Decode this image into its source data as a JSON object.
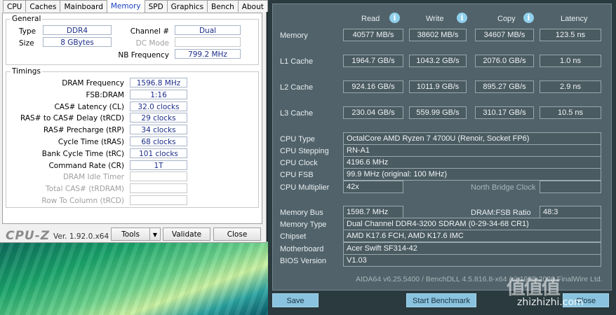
{
  "cpuz": {
    "tabs": [
      "CPU",
      "Caches",
      "Mainboard",
      "Memory",
      "SPD",
      "Graphics",
      "Bench",
      "About"
    ],
    "active_tab": "Memory",
    "general": {
      "title": "General",
      "type_label": "Type",
      "type_value": "DDR4",
      "size_label": "Size",
      "size_value": "8 GBytes",
      "channel_label": "Channel #",
      "channel_value": "Dual",
      "dcmode_label": "DC Mode",
      "dcmode_value": "",
      "nbfreq_label": "NB Frequency",
      "nbfreq_value": "799.2 MHz"
    },
    "timings": {
      "title": "Timings",
      "rows": [
        {
          "label": "DRAM Frequency",
          "value": "1596.8 MHz",
          "enabled": true
        },
        {
          "label": "FSB:DRAM",
          "value": "1:16",
          "enabled": true
        },
        {
          "label": "CAS# Latency (CL)",
          "value": "32.0 clocks",
          "enabled": true
        },
        {
          "label": "RAS# to CAS# Delay (tRCD)",
          "value": "29 clocks",
          "enabled": true
        },
        {
          "label": "RAS# Precharge (tRP)",
          "value": "34 clocks",
          "enabled": true
        },
        {
          "label": "Cycle Time (tRAS)",
          "value": "68 clocks",
          "enabled": true
        },
        {
          "label": "Bank Cycle Time (tRC)",
          "value": "101 clocks",
          "enabled": true
        },
        {
          "label": "Command Rate (CR)",
          "value": "1T",
          "enabled": true
        },
        {
          "label": "DRAM Idle Timer",
          "value": "",
          "enabled": false
        },
        {
          "label": "Total CAS# (tRDRAM)",
          "value": "",
          "enabled": false
        },
        {
          "label": "Row To Column (tRCD)",
          "value": "",
          "enabled": false
        }
      ]
    },
    "footer": {
      "logo": "CPU-Z",
      "version": "Ver. 1.92.0.x64",
      "tools": "Tools",
      "validate": "Validate",
      "close": "Close"
    }
  },
  "aida": {
    "headers": {
      "read": "Read",
      "write": "Write",
      "copy": "Copy",
      "latency": "Latency"
    },
    "bench_rows": [
      {
        "label": "Memory",
        "read": "40577 MB/s",
        "write": "38602 MB/s",
        "copy": "34607 MB/s",
        "latency": "123.5 ns"
      },
      {
        "label": "L1 Cache",
        "read": "1964.7 GB/s",
        "write": "1043.2 GB/s",
        "copy": "2076.0 GB/s",
        "latency": "1.0 ns"
      },
      {
        "label": "L2 Cache",
        "read": "924.16 GB/s",
        "write": "1011.9 GB/s",
        "copy": "895.27 GB/s",
        "latency": "2.9 ns"
      },
      {
        "label": "L3 Cache",
        "read": "230.04 GB/s",
        "write": "559.99 GB/s",
        "copy": "310.17 GB/s",
        "latency": "10.5 ns"
      }
    ],
    "cpu_info": {
      "cpu_type_label": "CPU Type",
      "cpu_type": "OctalCore AMD Ryzen 7 4700U  (Renoir, Socket FP6)",
      "cpu_stepping_label": "CPU Stepping",
      "cpu_stepping": "RN-A1",
      "cpu_clock_label": "CPU Clock",
      "cpu_clock": "4196.6 MHz",
      "cpu_fsb_label": "CPU FSB",
      "cpu_fsb": "99.9 MHz  (original: 100 MHz)",
      "cpu_multiplier_label": "CPU Multiplier",
      "cpu_multiplier": "42x",
      "nb_clock_label": "North Bridge Clock",
      "nb_clock": ""
    },
    "mem_info": {
      "memory_bus_label": "Memory Bus",
      "memory_bus": "1598.7 MHz",
      "ratio_label": "DRAM:FSB Ratio",
      "ratio": "48:3",
      "memory_type_label": "Memory Type",
      "memory_type": "Dual Channel DDR4-3200 SDRAM  (0-29-34-68 CR1)",
      "chipset_label": "Chipset",
      "chipset": "AMD K17.6 FCH, AMD K17.6 IMC",
      "motherboard_label": "Motherboard",
      "motherboard": "Acer Swift SF314-42",
      "bios_label": "BIOS Version",
      "bios": "V1.03"
    },
    "footer_text": "AIDA64 v6.25.5400 / BenchDLL 4.5.816.8-x64  (c) 1995-2020 FinalWire Ltd.",
    "buttons": {
      "save": "Save",
      "start": "Start Benchmark",
      "close": "Close"
    },
    "watermark": "值值值",
    "watermark_url": "zhizhizhi.com"
  }
}
